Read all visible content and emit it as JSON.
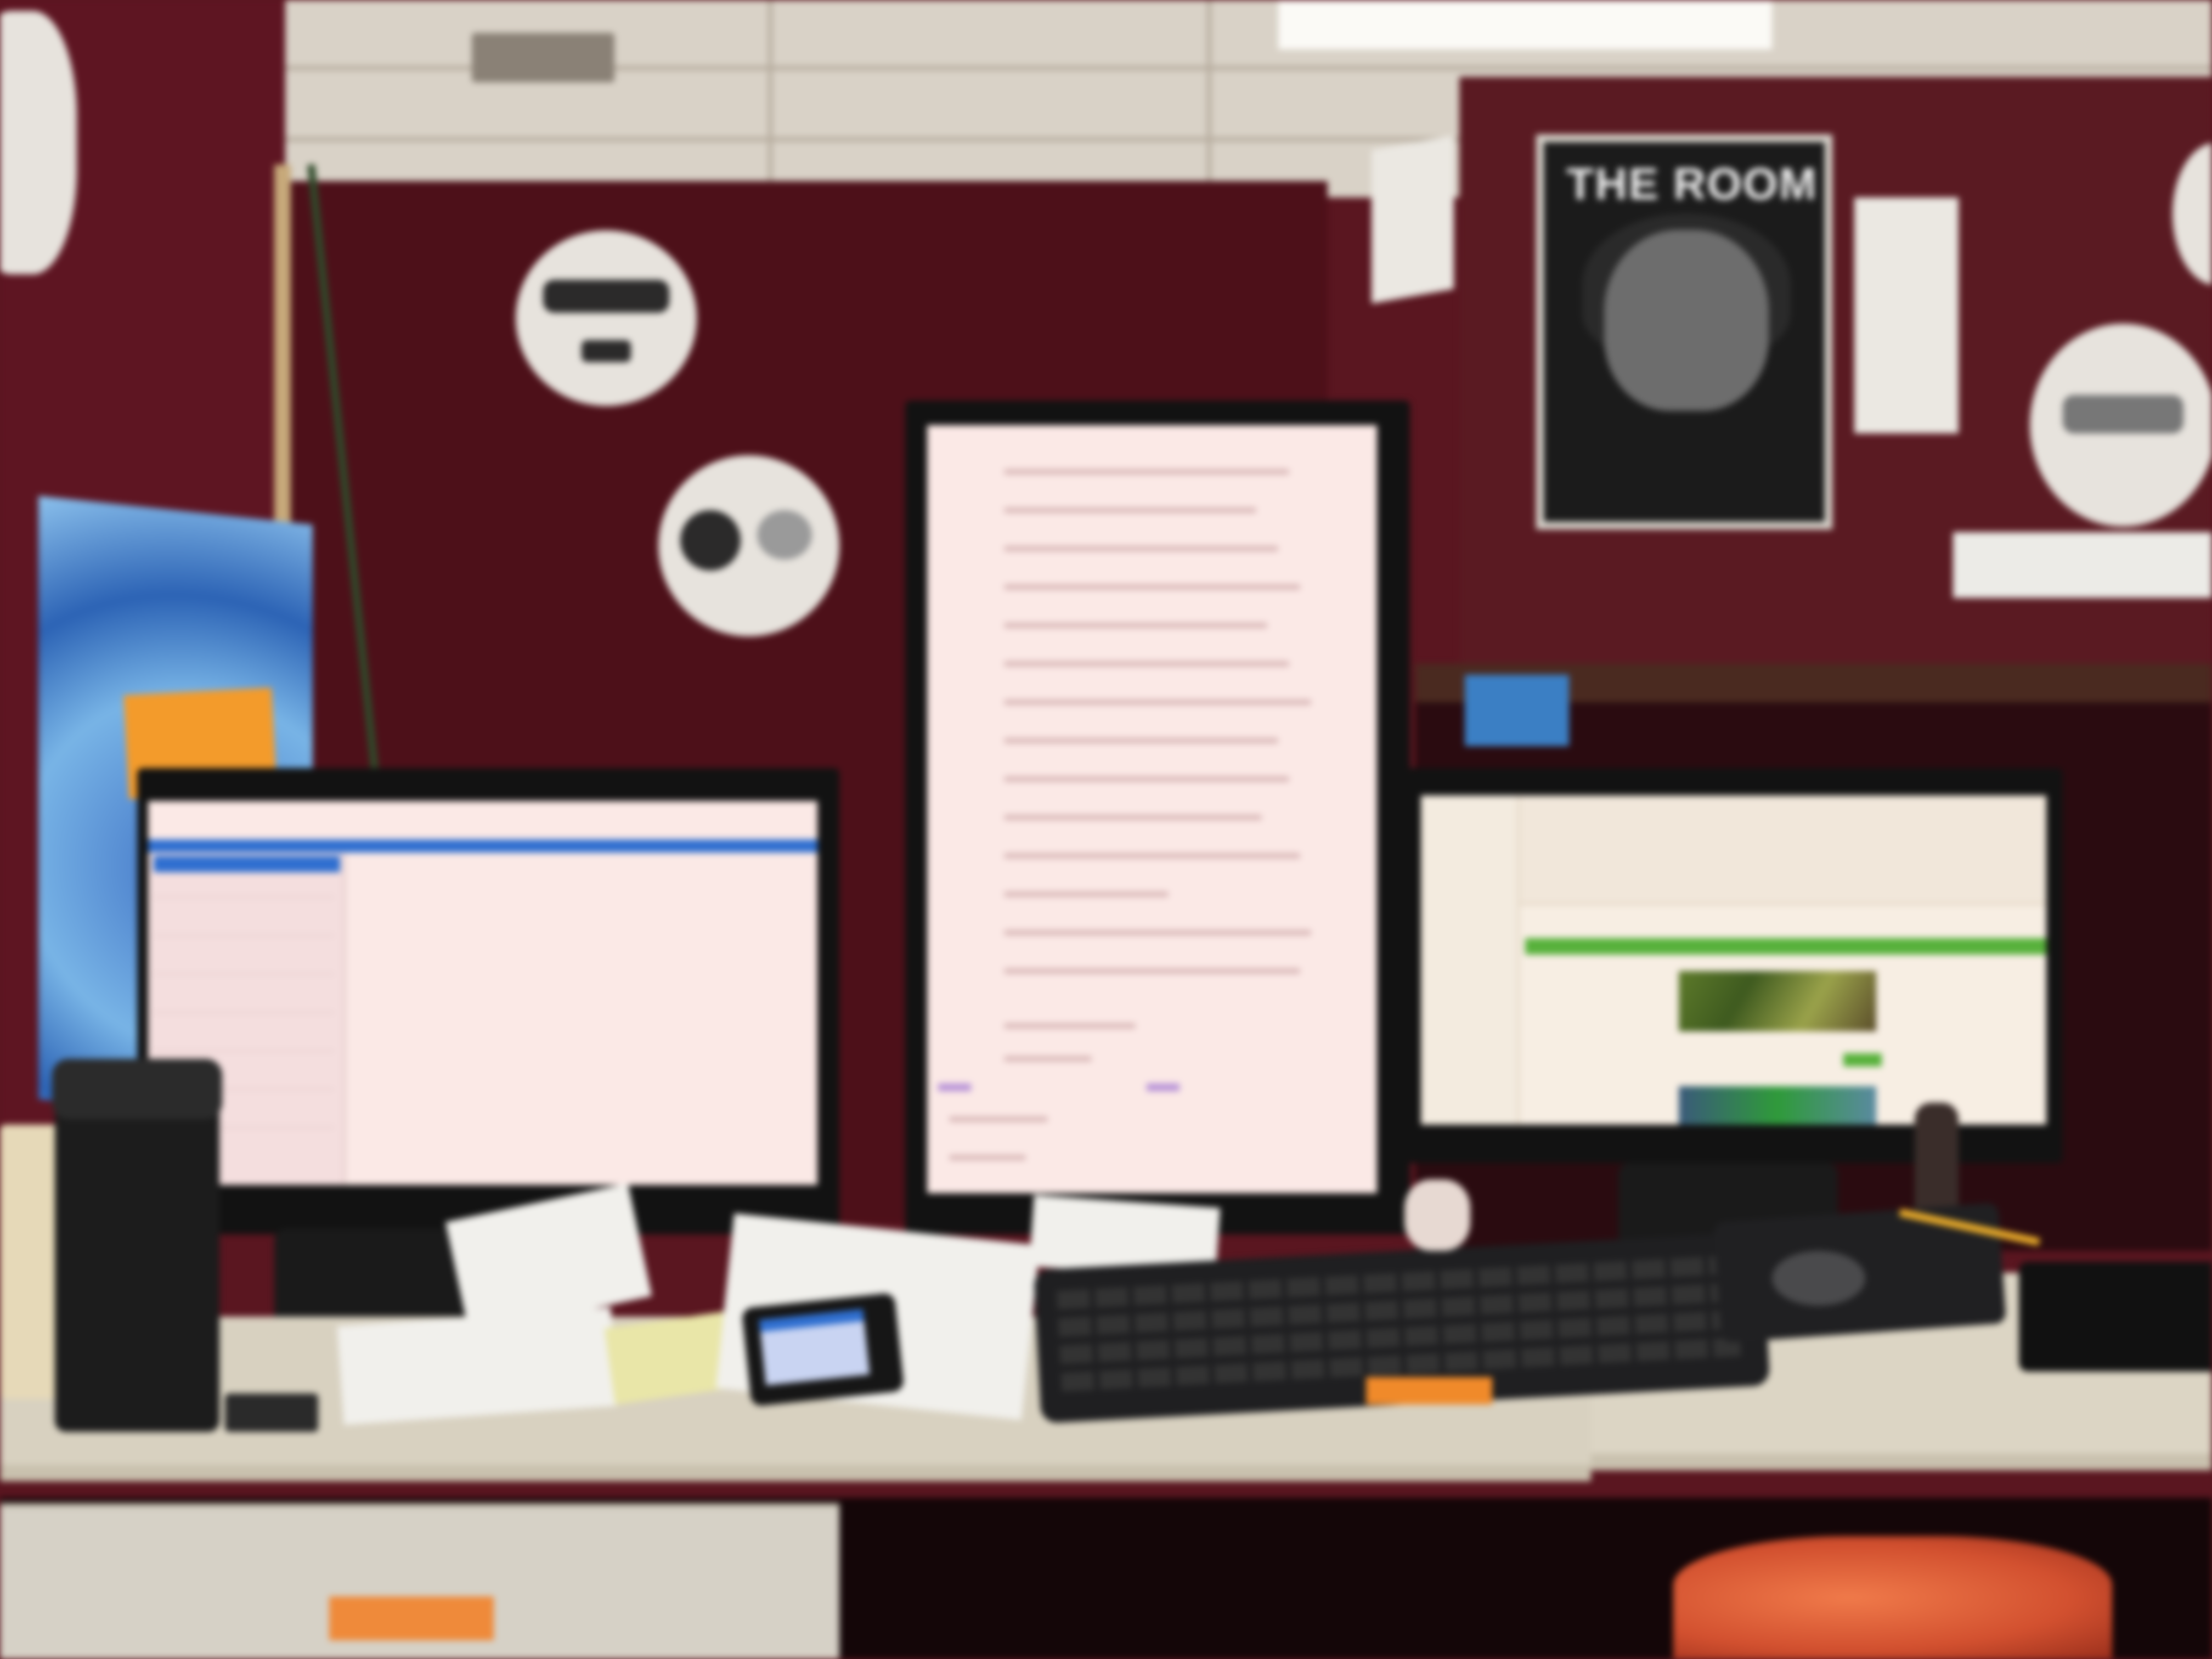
{
  "scene": {
    "description_type": "office cubicle photo with three monitors",
    "poster": {
      "title": "THE ROOM"
    }
  },
  "colors": {
    "wall": "#5a1620",
    "ceiling": "#d9d2c7",
    "desk": "#d8d1c0",
    "screen_blue": "#2f6fd0",
    "screen_green": "#57b13b"
  },
  "icons": [
    "skull-decoration",
    "stormtrooper-decoration",
    "poster",
    "keyboard",
    "mouse",
    "phone",
    "tumbler"
  ]
}
